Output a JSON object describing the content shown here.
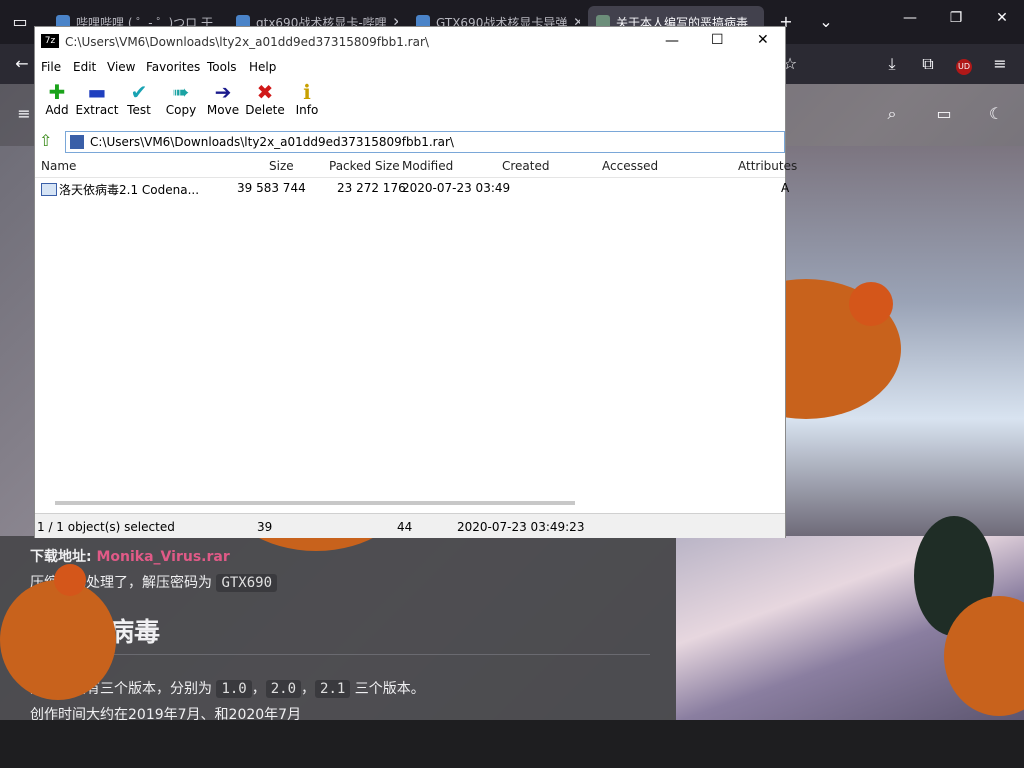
{
  "browser": {
    "tabs": [
      {
        "title": "哔哩哔哩 ( ゜- ゜)つロ 干"
      },
      {
        "title": "gtx690战术核显卡-哔哩"
      },
      {
        "title": "GTX690战术核显卡导弹"
      },
      {
        "title": "关于本人编写的恶搞病毒"
      }
    ],
    "new_tab_icon": "plus-icon",
    "tab_list_icon": "chevron-down-icon"
  },
  "zip": {
    "title": "C:\\Users\\VM6\\Downloads\\lty2x_a01dd9ed37315809fbb1.rar\\",
    "menu": [
      "File",
      "Edit",
      "View",
      "Favorites",
      "Tools",
      "Help"
    ],
    "tools": [
      {
        "label": "Add",
        "icon": "plus-icon",
        "color": "#1aa31a"
      },
      {
        "label": "Extract",
        "icon": "minus-icon",
        "color": "#1f3fbf"
      },
      {
        "label": "Test",
        "icon": "check-icon",
        "color": "#19a3b3"
      },
      {
        "label": "Copy",
        "icon": "double-arrow-icon",
        "color": "#1aa3a3"
      },
      {
        "label": "Move",
        "icon": "arrow-right-icon",
        "color": "#1a1a8c"
      },
      {
        "label": "Delete",
        "icon": "x-icon",
        "color": "#d01818"
      },
      {
        "label": "Info",
        "icon": "info-icon",
        "color": "#c8a000"
      }
    ],
    "address": "C:\\Users\\VM6\\Downloads\\lty2x_a01dd9ed37315809fbb1.rar\\",
    "columns": [
      "Name",
      "Size",
      "Packed Size",
      "Modified",
      "Created",
      "Accessed",
      "Attributes"
    ],
    "rows": [
      {
        "name": "洛天依病毒2.1 Codena...",
        "size": "39 583 744",
        "packed": "23 272 176",
        "modified": "2020-07-23 03:49",
        "created": "",
        "accessed": "",
        "attributes": "A"
      }
    ],
    "status": {
      "selected": "1 / 1 object(s) selected",
      "size": "39",
      "packed": "44",
      "modified": "2020-07-23 03:49:23"
    }
  },
  "article": {
    "download_label": "下载地址:",
    "download_link": "Monika_Virus.rar",
    "password_prefix": "压缩包已处理了，解压密码为",
    "password": "GTX690",
    "heading": "洛天依病毒",
    "versions_prefix": "病毒一共有三个版本，分别为",
    "v1": "1.0",
    "v2": "2.0",
    "v3": "2.1",
    "versions_suffix": "三个版本。",
    "created": "创作时间大约在2019年7月、和2020年7月"
  }
}
